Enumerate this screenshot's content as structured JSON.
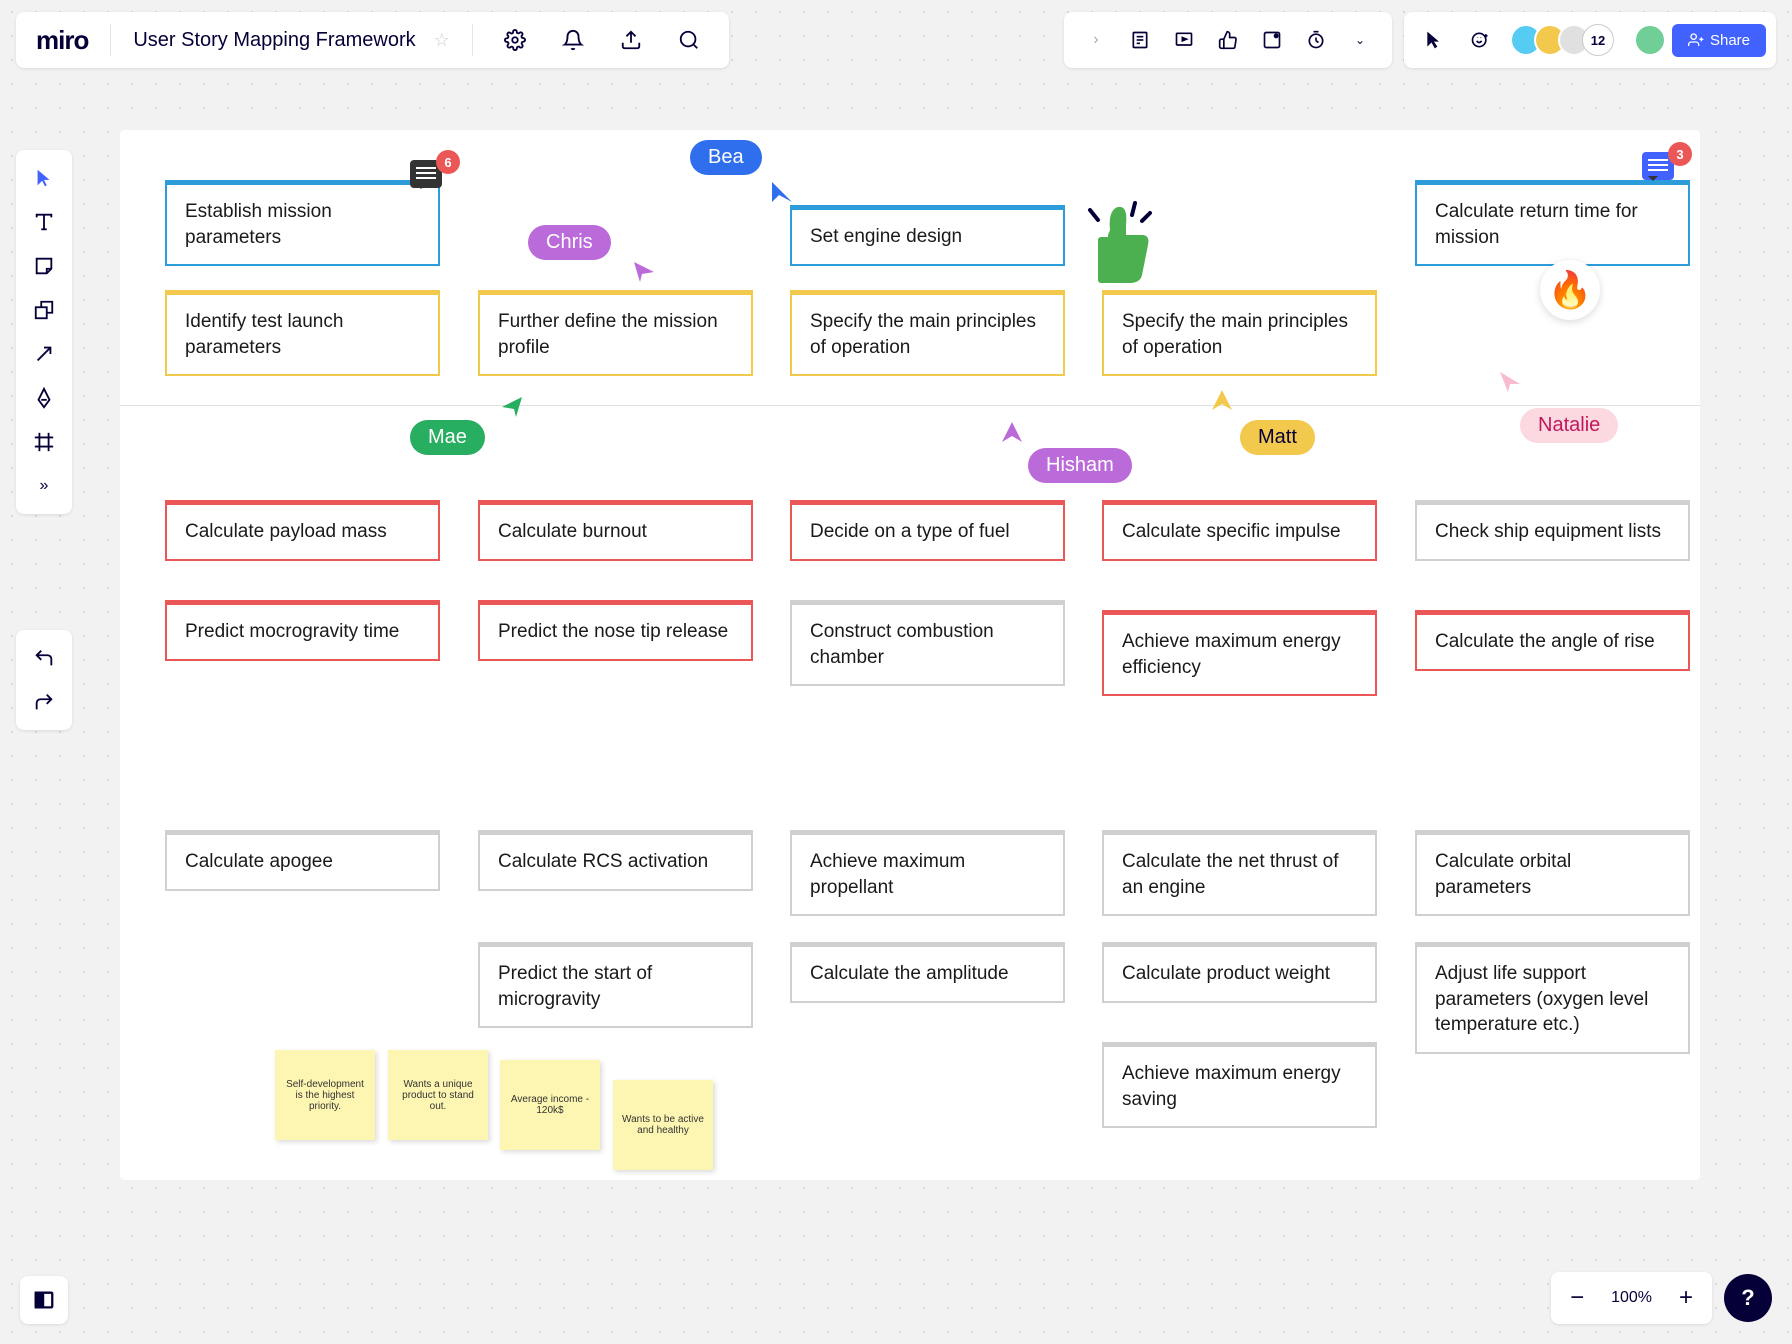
{
  "header": {
    "logo": "miro",
    "title": "User Story Mapping Framework",
    "share_label": "Share",
    "avatar_count": "12"
  },
  "users": {
    "bea": "Bea",
    "chris": "Chris",
    "mae": "Mae",
    "hisham": "Hisham",
    "matt": "Matt",
    "natalie": "Natalie"
  },
  "cards": {
    "c1": "Establish mission parameters",
    "c2": "Set engine design",
    "c3": "Calculate return time for mission",
    "c4": "Identify test launch parameters",
    "c5": "Further define the mission profile",
    "c6": "Specify the main principles of operation",
    "c7": "Specify the main principles of operation",
    "c8": "Calculate payload mass",
    "c9": "Calculate burnout",
    "c10": "Decide on a type of fuel",
    "c11": "Calculate specific impulse",
    "c12": "Check ship equipment lists",
    "c13": "Predict mocrogravity time",
    "c14": "Predict the nose tip release",
    "c15": "Construct combustion chamber",
    "c16": "Achieve maximum energy efficiency",
    "c17": "Calculate the angle of rise",
    "c18": "Calculate apogee",
    "c19": "Calculate RCS activation",
    "c20": "Achieve maximum propellant",
    "c21": "Calculate the net thrust of an engine",
    "c22": "Calculate orbital parameters",
    "c23": "Predict the start of microgravity",
    "c24": "Calculate the amplitude",
    "c25": "Calculate product weight",
    "c26": "Adjust life support parameters (oxygen level temperature etc.)",
    "c27": "Achieve maximum energy saving"
  },
  "stickies": {
    "s1": "Self-development is the highest priority.",
    "s2": "Wants a unique product to stand out.",
    "s3": "Average income - 120k$",
    "s4": "Wants to be active and healthy"
  },
  "badges": {
    "b1": "6",
    "b2": "3"
  },
  "zoom": "100%"
}
